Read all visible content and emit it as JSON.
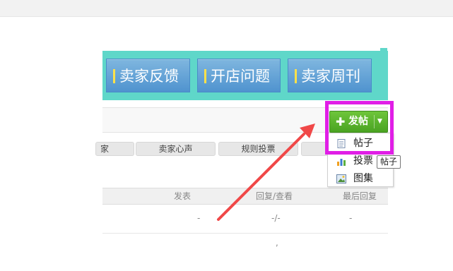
{
  "banner": {
    "buttons": [
      {
        "label": "卖家反馈"
      },
      {
        "label": "开店问题"
      },
      {
        "label": "卖家周刊"
      }
    ]
  },
  "categories": [
    {
      "label": "家"
    },
    {
      "label": "卖家心声"
    },
    {
      "label": "规则投票"
    }
  ],
  "post_button": {
    "plus": "✚",
    "label": "发帖",
    "caret": "▼"
  },
  "dropdown": {
    "items": [
      {
        "label": "帖子",
        "icon": "document-icon"
      },
      {
        "label": "投票",
        "icon": "bar-chart-icon"
      },
      {
        "label": "图集",
        "icon": "image-icon"
      }
    ]
  },
  "tooltip": {
    "text": "帖子"
  },
  "table": {
    "headers": [
      "发表",
      "回复/查看",
      "最后回复"
    ],
    "row": [
      "-",
      "-/-",
      "-"
    ],
    "partial": ","
  },
  "colors": {
    "banner_bg": "#5fd7c9",
    "banner_btn": "#4f93cf",
    "post_button": "#4aa322",
    "highlight": "#e01ee6",
    "arrow": "#f04848"
  }
}
